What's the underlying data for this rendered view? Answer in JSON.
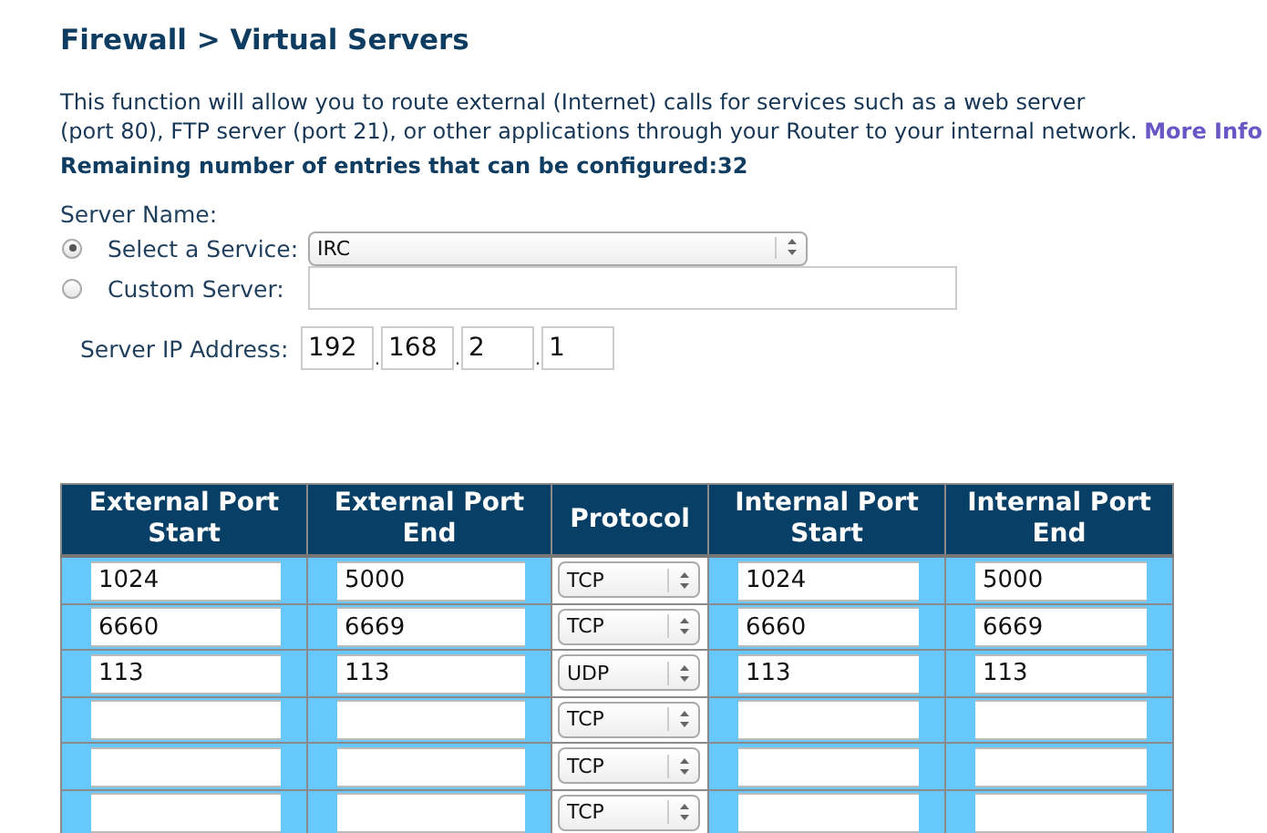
{
  "title": "Firewall > Virtual Servers",
  "description": {
    "lines": [
      "This function will allow you to route external (Internet) calls for services such as a web server",
      "(port 80), FTP server (port 21), or other applications through your Router to your internal network."
    ],
    "link": "More Info"
  },
  "remaining": "Remaining number of entries that can be configured:32",
  "server_name": {
    "label": "Server Name:",
    "options": [
      {
        "kind": "select",
        "label": "Select a Service:",
        "selected": true,
        "value": "IRC"
      },
      {
        "kind": "text",
        "label": "Custom Server:",
        "selected": false
      }
    ]
  },
  "server_ip": {
    "label": "Server IP Address:",
    "octets": [
      "192",
      "168",
      "2",
      "1"
    ],
    "separators": [
      ".",
      ".",
      "."
    ]
  },
  "table": {
    "columns": [
      "External Port Start",
      "External Port End",
      "Protocol",
      "Internal Port Start",
      "Internal Port End"
    ],
    "rows": [
      {
        "external_start": "1024",
        "external_end": "5000",
        "protocol": "TCP",
        "internal_start": "1024",
        "internal_end": "5000"
      },
      {
        "external_start": "6660",
        "external_end": "6669",
        "protocol": "TCP",
        "internal_start": "6660",
        "internal_end": "6669"
      },
      {
        "external_start": "113",
        "external_end": "113",
        "protocol": "UDP",
        "internal_start": "113",
        "internal_end": "113"
      },
      {
        "protocol": "TCP"
      },
      {
        "protocol": "TCP"
      },
      {
        "protocol": "TCP"
      }
    ]
  }
}
